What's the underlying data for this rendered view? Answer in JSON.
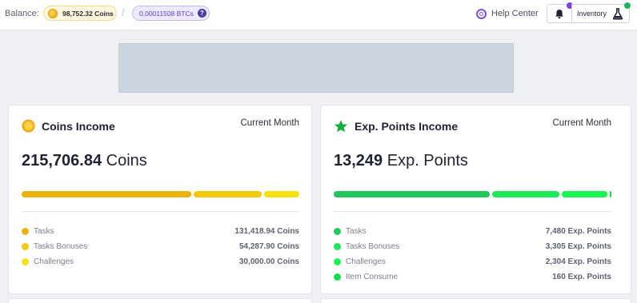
{
  "topbar": {
    "balance_label": "Balance:",
    "coins_balance": "98,752.32 Coins",
    "btc_balance": "0.00011508 BTCs",
    "help_center": "Help Center",
    "inventory": "Inventory"
  },
  "colors": {
    "coins_bar": [
      "#e9b20c",
      "#f2c90f",
      "#f6e010"
    ],
    "exp_bar": [
      "#22c55e",
      "#1ee85a",
      "#1af352",
      "#10e04c"
    ],
    "accent_purple": "#7b3fe4"
  },
  "coins_card": {
    "title": "Coins Income",
    "period": "Current Month",
    "total_value": "215,706.84",
    "total_unit": "Coins",
    "rows": [
      {
        "label": "Tasks",
        "value": "131,418.94 Coins",
        "color": "#e9b20c"
      },
      {
        "label": "Tasks Bonuses",
        "value": "54,287.90 Coins",
        "color": "#f2c90f"
      },
      {
        "label": "Challenges",
        "value": "30,000.00 Coins",
        "color": "#f6e010"
      }
    ]
  },
  "exp_card": {
    "title": "Exp. Points Income",
    "period": "Current Month",
    "total_value": "13,249",
    "total_unit": "Exp. Points",
    "rows": [
      {
        "label": "Tasks",
        "value": "7,480 Exp. Points",
        "color": "#22c55e"
      },
      {
        "label": "Tasks Bonuses",
        "value": "3,305 Exp. Points",
        "color": "#1ee85a"
      },
      {
        "label": "Challenges",
        "value": "2,304 Exp. Points",
        "color": "#1af352"
      },
      {
        "label": "Item Consume",
        "value": "160 Exp. Points",
        "color": "#10e04c"
      }
    ]
  },
  "icons": {
    "coin": "coin-icon",
    "star": "star-icon",
    "bell": "bell-icon",
    "flask": "flask-icon",
    "help": "lifebuoy-icon",
    "question": "question-icon"
  }
}
